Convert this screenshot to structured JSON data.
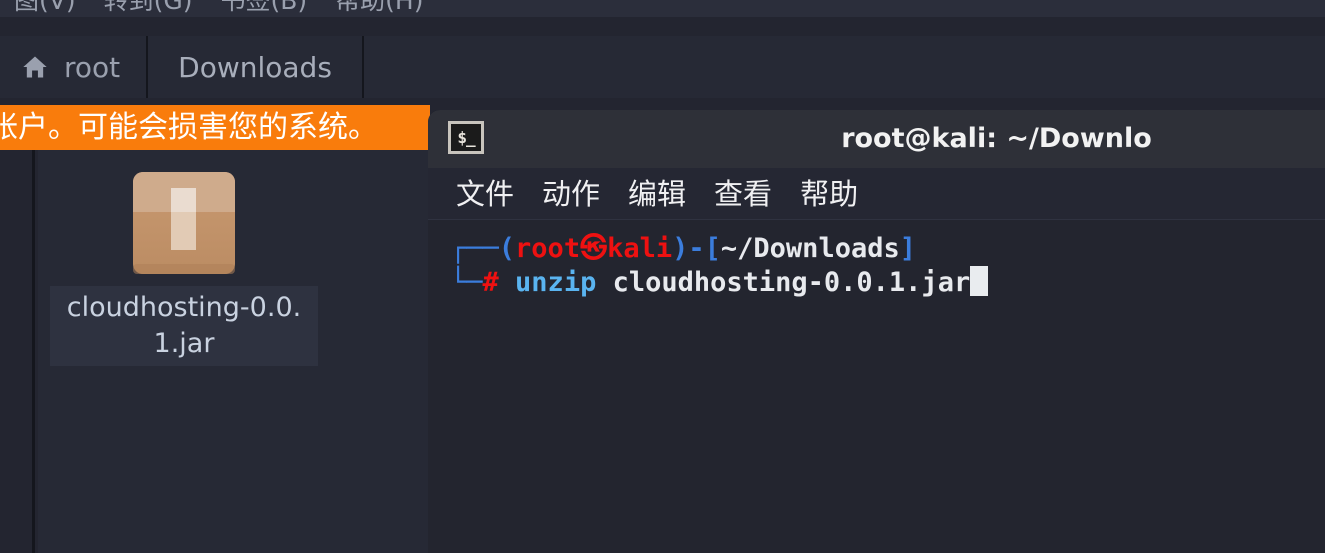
{
  "file_manager": {
    "menubar": {
      "items": [
        {
          "label": "图(V)",
          "name": "menu-view"
        },
        {
          "label": "转到(G)",
          "name": "menu-go"
        },
        {
          "label": "书签(B)",
          "name": "menu-bookmarks"
        },
        {
          "label": "帮助(H)",
          "name": "menu-help"
        }
      ]
    },
    "breadcrumb": {
      "home_label": "root",
      "home_icon": "home-icon",
      "current_label": "Downloads"
    },
    "banner": {
      "text": "帐户。可能会损害您的系统。",
      "color": "#f97c0c"
    },
    "files": [
      {
        "name": "cloudhosting-0.0.1.jar",
        "icon": "package-archive-icon",
        "selected": true
      }
    ]
  },
  "terminal": {
    "title": "root@kali: ~/Downlo",
    "icon": "terminal-icon",
    "icon_glyph": "$_",
    "menubar": {
      "items": [
        {
          "label": "文件",
          "name": "term-menu-file"
        },
        {
          "label": "动作",
          "name": "term-menu-actions"
        },
        {
          "label": "编辑",
          "name": "term-menu-edit"
        },
        {
          "label": "查看",
          "name": "term-menu-view"
        },
        {
          "label": "帮助",
          "name": "term-menu-help"
        }
      ]
    },
    "prompt": {
      "user": "root",
      "separator": "㉿",
      "host": "kali",
      "path": "~/Downloads",
      "open_paren": "(",
      "close_paren": ")",
      "dash": "-",
      "open_bracket": "[",
      "close_bracket": "]",
      "hash": "#"
    },
    "command": "unzip cloudhosting-0.0.1.jar",
    "colors": {
      "red": "#ee1111",
      "blue": "#3b7ddd",
      "cyan": "#5ab4f0",
      "white": "#e8eaee",
      "background": "#23252f"
    }
  }
}
